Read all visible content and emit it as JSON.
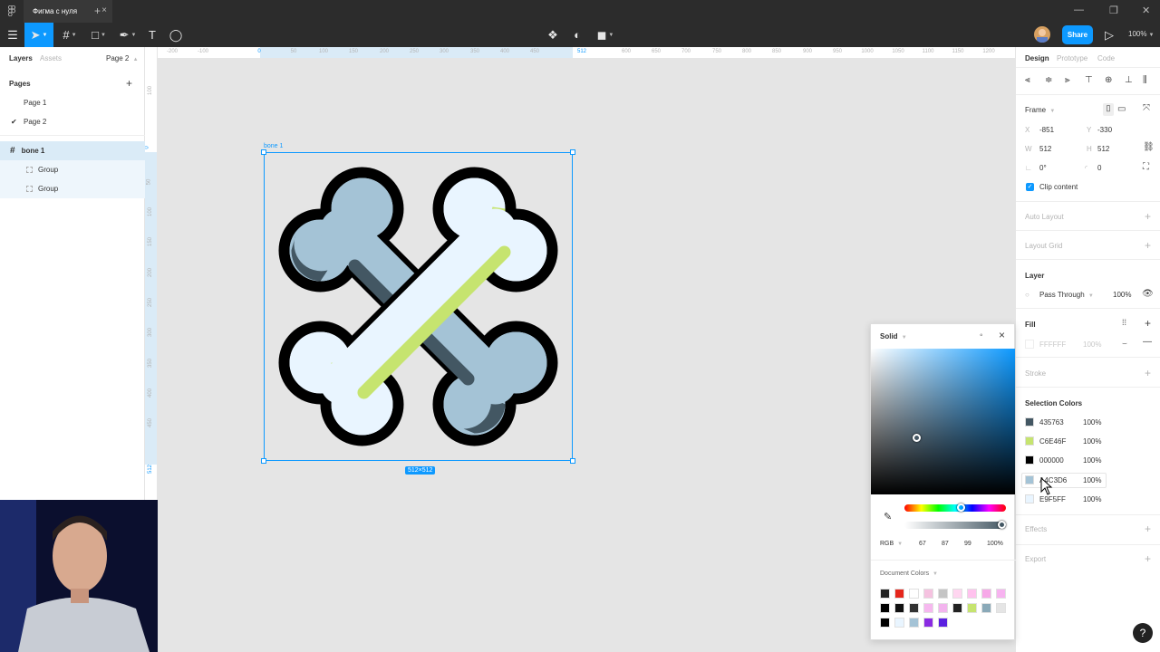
{
  "window": {
    "tab_title": "Фигма с нуля",
    "tab_close": "×",
    "new_tab": "+"
  },
  "toolbar": {
    "share_label": "Share",
    "zoom": "100%",
    "play": "▷"
  },
  "left_panel": {
    "tabs": [
      "Layers",
      "Assets"
    ],
    "current_page": "Page 2",
    "pages_label": "Pages",
    "pages": [
      "Page 1",
      "Page 2"
    ],
    "layers": [
      {
        "name": "bone 1",
        "type": "frame"
      },
      {
        "name": "Group",
        "type": "group"
      },
      {
        "name": "Group",
        "type": "group"
      }
    ]
  },
  "rulers": {
    "top": [
      "-200",
      "-100",
      "0",
      "50",
      "100",
      "150",
      "200",
      "250",
      "300",
      "350",
      "400",
      "450",
      "512",
      "600",
      "650",
      "700",
      "750",
      "800",
      "850",
      "900",
      "950",
      "1000",
      "1050",
      "1100",
      "1150",
      "1200"
    ],
    "left": [
      "100",
      "0",
      "50",
      "100",
      "150",
      "200",
      "250",
      "300",
      "350",
      "400",
      "450",
      "512"
    ]
  },
  "canvas": {
    "frame_label": "bone 1",
    "frame_size": "512×512",
    "colors": {
      "shadow": "#435763",
      "accent": "#C6E46F",
      "outline": "#000000",
      "dark_bone": "#A4C3D6",
      "light_bone": "#E9F5FF"
    }
  },
  "right_panel": {
    "tabs": [
      "Design",
      "Prototype",
      "Code"
    ],
    "frame_label": "Frame",
    "x_label": "X",
    "x": "-851",
    "y_label": "Y",
    "y": "-330",
    "w_label": "W",
    "w": "512",
    "h_label": "H",
    "h": "512",
    "rotation": "0°",
    "radius": "0",
    "clip_content": "Clip content",
    "auto_layout": "Auto Layout",
    "layout_grid": "Layout Grid",
    "layer": "Layer",
    "blend": "Pass Through",
    "layer_opacity": "100%",
    "fill": "Fill",
    "fill_hex": "FFFFFF",
    "fill_opacity": "100%",
    "stroke": "Stroke",
    "selection_colors": "Selection Colors",
    "selection": [
      {
        "hex": "435763",
        "pct": "100%",
        "color": "#435763"
      },
      {
        "hex": "C6E46F",
        "pct": "100%",
        "color": "#C6E46F"
      },
      {
        "hex": "000000",
        "pct": "100%",
        "color": "#000000"
      },
      {
        "hex": "A4C3D6",
        "pct": "100%",
        "color": "#A4C3D6"
      },
      {
        "hex": "E9F5FF",
        "pct": "100%",
        "color": "#E9F5FF"
      }
    ],
    "effects": "Effects",
    "export": "Export"
  },
  "picker": {
    "mode": "Solid",
    "model": "RGB",
    "r": "67",
    "g": "87",
    "b": "99",
    "a": "100%",
    "doc_colors_label": "Document Colors",
    "doc_colors": [
      "#222222",
      "#e5261c",
      "#ffffff",
      "#f5c2e0",
      "#c4c4c4",
      "#ffd6f0",
      "#ffc2ee",
      "#f7a8e8",
      "#f7b3f0",
      "#000000",
      "#111111",
      "#333333",
      "#f6b8ef",
      "#f3b4ee",
      "#222222",
      "#c6e46f",
      "#8aa9b8",
      "#e5e5e5",
      "#000000",
      "#e9f5ff",
      "#a4c3d6",
      "#8a2be2",
      "#5b21e0"
    ]
  }
}
